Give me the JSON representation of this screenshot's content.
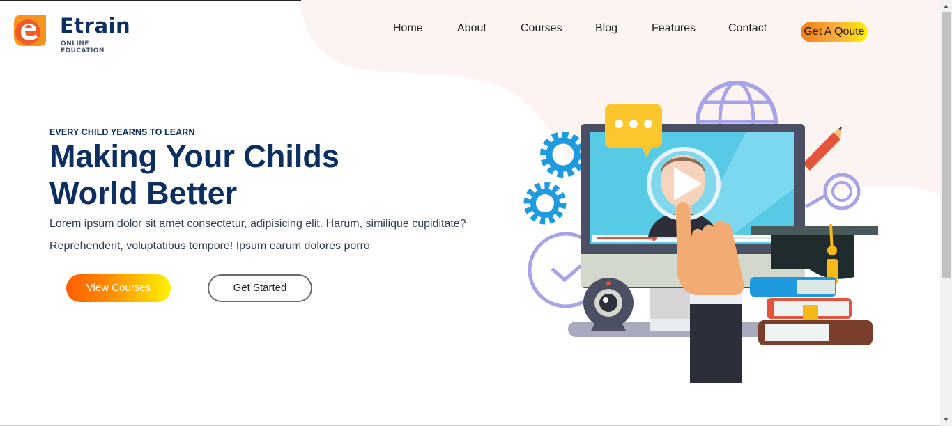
{
  "brand": {
    "name": "Etrain",
    "tagline": "ONLINE EDUCATION",
    "logo_colors": {
      "orange": "#f15a24",
      "yellow": "#f7931e"
    }
  },
  "nav": {
    "items": [
      {
        "label": "Home"
      },
      {
        "label": "About"
      },
      {
        "label": "Courses"
      },
      {
        "label": "Blog"
      },
      {
        "label": "Features"
      },
      {
        "label": "Contact"
      }
    ],
    "cta_label": "Get A Qoute"
  },
  "hero": {
    "eyebrow": "EVERY CHILD YEARNS TO LEARN",
    "headline": "Making Your Childs World Better",
    "paragraph_line1": "Lorem ipsum dolor sit amet consectetur, adipisicing elit. Harum, similique cupiditate?",
    "paragraph_line2": "Reprehenderit, voluptatibus tempore! Ipsum earum dolores porro",
    "primary_button": "View Courses",
    "secondary_button": "Get Started"
  },
  "illustration": {
    "icons": [
      "gear-icon",
      "chat-bubble-icon",
      "globe-icon",
      "pencil-icon",
      "clock-icon",
      "webcam-icon",
      "graduation-cap-icon",
      "books-icon",
      "play-icon"
    ],
    "video_progress": 0.3
  },
  "colors": {
    "heading": "#0c2e60",
    "accent_orange": "#ff5e00",
    "accent_yellow": "#fff200",
    "background_blob": "#fdf3f1"
  }
}
